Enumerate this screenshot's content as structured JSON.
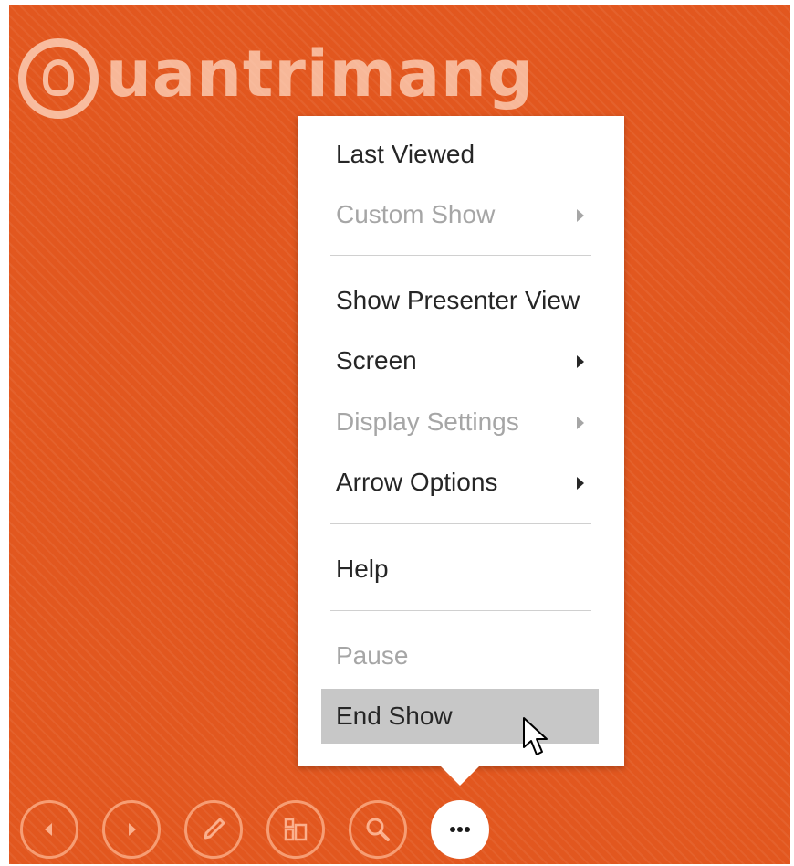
{
  "watermark": {
    "text": "uantrimang",
    "icon": "bulb-logo-icon"
  },
  "menu": {
    "items": [
      {
        "label": "Last Viewed",
        "enabled": true,
        "submenu": false
      },
      {
        "label": "Custom Show",
        "enabled": false,
        "submenu": true
      },
      {
        "label": "Show Presenter View",
        "enabled": true,
        "submenu": false
      },
      {
        "label": "Screen",
        "enabled": true,
        "submenu": true
      },
      {
        "label": "Display Settings",
        "enabled": false,
        "submenu": true
      },
      {
        "label": "Arrow Options",
        "enabled": true,
        "submenu": true
      },
      {
        "label": "Help",
        "enabled": true,
        "submenu": false
      },
      {
        "label": "Pause",
        "enabled": false,
        "submenu": false
      },
      {
        "label": "End Show",
        "enabled": true,
        "submenu": false,
        "highlighted": true
      }
    ]
  },
  "toolbar": {
    "buttons": [
      {
        "name": "previous-slide",
        "icon": "chevron-left-icon"
      },
      {
        "name": "next-slide",
        "icon": "chevron-right-icon"
      },
      {
        "name": "pen-tools",
        "icon": "pen-icon"
      },
      {
        "name": "see-all-slides",
        "icon": "slides-grid-icon"
      },
      {
        "name": "zoom",
        "icon": "magnifier-icon"
      },
      {
        "name": "more-options",
        "icon": "ellipsis-icon",
        "active": true
      }
    ]
  },
  "colors": {
    "slide_background": "#e2571f",
    "menu_background": "#ffffff",
    "highlight": "#c7c7c7",
    "disabled_text": "#a6a6a6",
    "text": "#262626"
  }
}
